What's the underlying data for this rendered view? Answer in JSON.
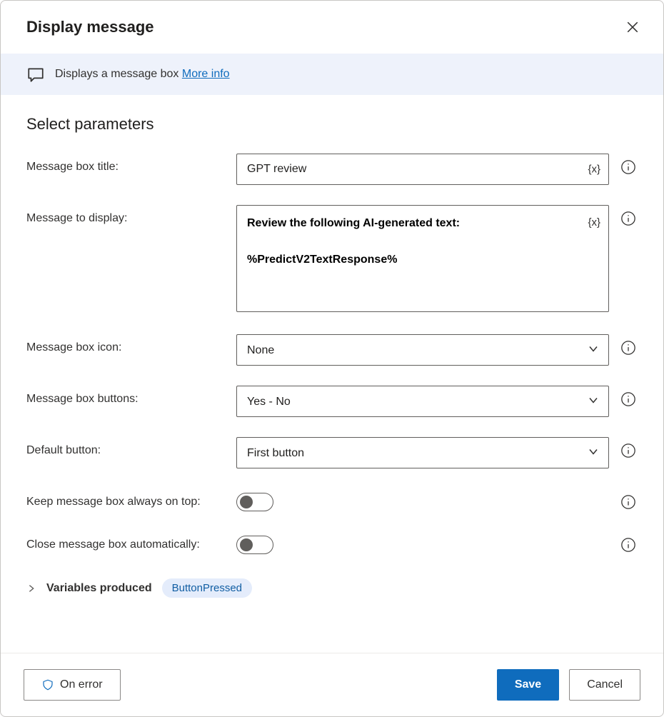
{
  "dialog": {
    "title": "Display message"
  },
  "info_band": {
    "text": "Displays a message box ",
    "link_text": "More info"
  },
  "section_heading": "Select parameters",
  "fields": {
    "title": {
      "label": "Message box title:",
      "value": "GPT review"
    },
    "message": {
      "label": "Message to display:",
      "value": "Review the following AI-generated text:\n\n%PredictV2TextResponse%"
    },
    "icon": {
      "label": "Message box icon:",
      "value": "None"
    },
    "buttons": {
      "label": "Message box buttons:",
      "value": "Yes - No"
    },
    "default_button": {
      "label": "Default button:",
      "value": "First button"
    },
    "always_on_top": {
      "label": "Keep message box always on top:",
      "value": false
    },
    "auto_close": {
      "label": "Close message box automatically:",
      "value": false
    }
  },
  "variables_produced": {
    "label": "Variables produced",
    "chips": [
      "ButtonPressed"
    ]
  },
  "footer": {
    "on_error": "On error",
    "save": "Save",
    "cancel": "Cancel"
  },
  "var_token": "{x}"
}
